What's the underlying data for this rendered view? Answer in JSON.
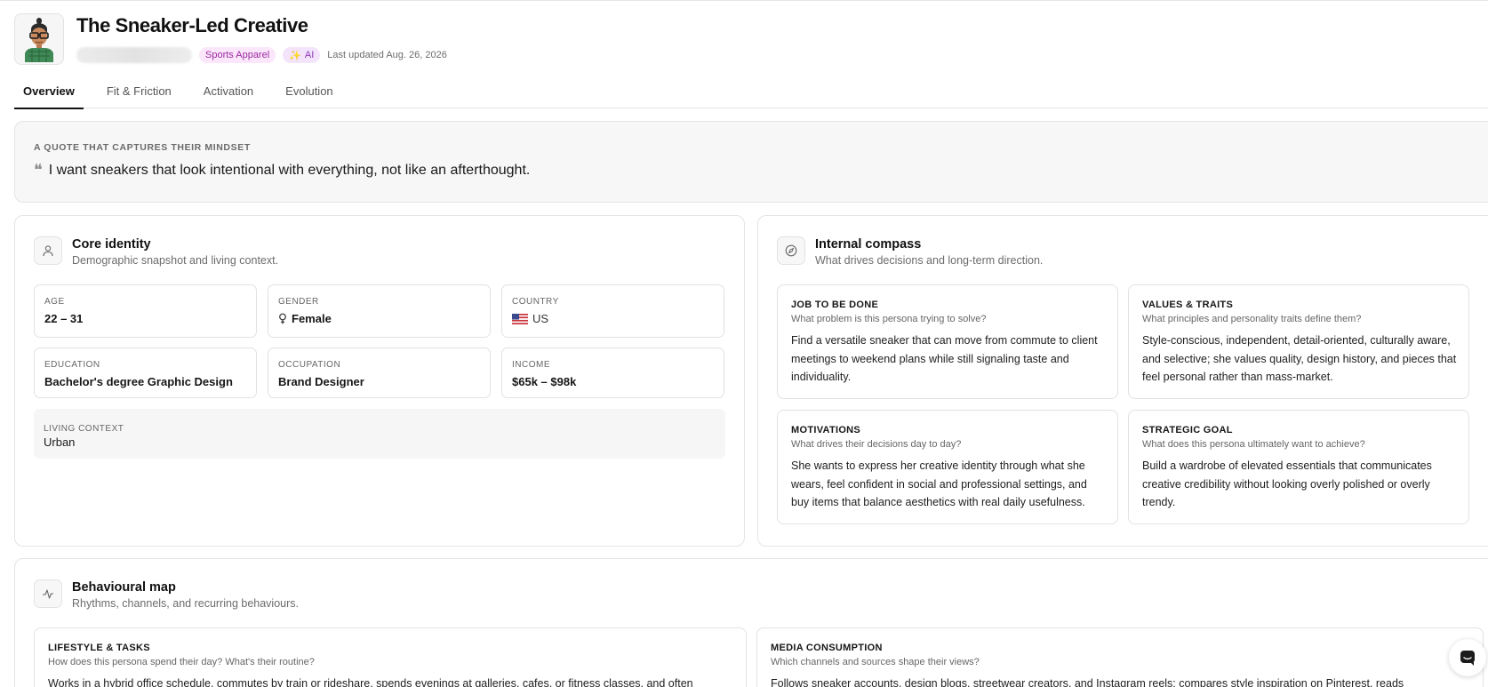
{
  "header": {
    "title": "The Sneaker-Led Creative",
    "badges": {
      "category": "Sports Apparel",
      "ai": "AI"
    },
    "last_updated": "Last updated Aug. 26, 2026"
  },
  "tabs": [
    {
      "label": "Overview",
      "active": true
    },
    {
      "label": "Fit & Friction",
      "active": false
    },
    {
      "label": "Activation",
      "active": false
    },
    {
      "label": "Evolution",
      "active": false
    }
  ],
  "quote": {
    "eyebrow": "A QUOTE THAT CAPTURES THEIR MINDSET",
    "text": "I want sneakers that look intentional with everything, not like an afterthought."
  },
  "core_identity": {
    "title": "Core identity",
    "subtitle": "Demographic snapshot and living context.",
    "fields": {
      "age": {
        "label": "AGE",
        "value": "22 – 31"
      },
      "gender": {
        "label": "GENDER",
        "value": "Female"
      },
      "country": {
        "label": "COUNTRY",
        "value": "US"
      },
      "education": {
        "label": "EDUCATION",
        "value": "Bachelor's degree Graphic Design"
      },
      "occupation": {
        "label": "OCCUPATION",
        "value": "Brand Designer"
      },
      "income": {
        "label": "INCOME",
        "value": "$65k – $98k"
      },
      "living": {
        "label": "LIVING CONTEXT",
        "value": "Urban"
      }
    }
  },
  "internal_compass": {
    "title": "Internal compass",
    "subtitle": "What drives decisions and long-term direction.",
    "items": {
      "job": {
        "title": "JOB TO BE DONE",
        "question": "What problem is this persona trying to solve?",
        "body": "Find a versatile sneaker that can move from commute to client meetings to weekend plans while still signaling taste and individuality."
      },
      "values": {
        "title": "VALUES & TRAITS",
        "question": "What principles and personality traits define them?",
        "body": "Style-conscious, independent, detail-oriented, culturally aware, and selective; she values quality, design history, and pieces that feel personal rather than mass-market."
      },
      "motivations": {
        "title": "MOTIVATIONS",
        "question": "What drives their decisions day to day?",
        "body": "She wants to express her creative identity through what she wears, feel confident in social and professional settings, and buy items that balance aesthetics with real daily usefulness."
      },
      "goal": {
        "title": "STRATEGIC GOAL",
        "question": "What does this persona ultimately want to achieve?",
        "body": "Build a wardrobe of elevated essentials that communicates creative credibility without looking overly polished or overly trendy."
      }
    }
  },
  "behavioural_map": {
    "title": "Behavioural map",
    "subtitle": "Rhythms, channels, and recurring behaviours.",
    "items": {
      "lifestyle": {
        "title": "LIFESTYLE & TASKS",
        "question": "How does this persona spend their day? What's their routine?",
        "body": "Works in a hybrid office schedule, commutes by train or rideshare, spends evenings at galleries, cafes, or fitness classes, and often"
      },
      "media": {
        "title": "MEDIA CONSUMPTION",
        "question": "Which channels and sources shape their views?",
        "body": "Follows sneaker accounts, design blogs, streetwear creators, and Instagram reels; compares style inspiration on Pinterest, reads"
      }
    }
  },
  "icons": {
    "avatar": "persona-avatar",
    "quote": "quote-mark-icon",
    "core": "user-icon",
    "compass": "compass-icon",
    "behaviour": "activity-icon",
    "gender": "gender-female-icon",
    "country": "us-flag-icon",
    "chat": "chat-icon"
  },
  "colors": {
    "badge_category_bg": "#fbe6fb",
    "badge_category_fg": "#9a2a9e",
    "badge_ai_bg": "#f3e3fb",
    "badge_ai_fg": "#8b3ab3"
  }
}
